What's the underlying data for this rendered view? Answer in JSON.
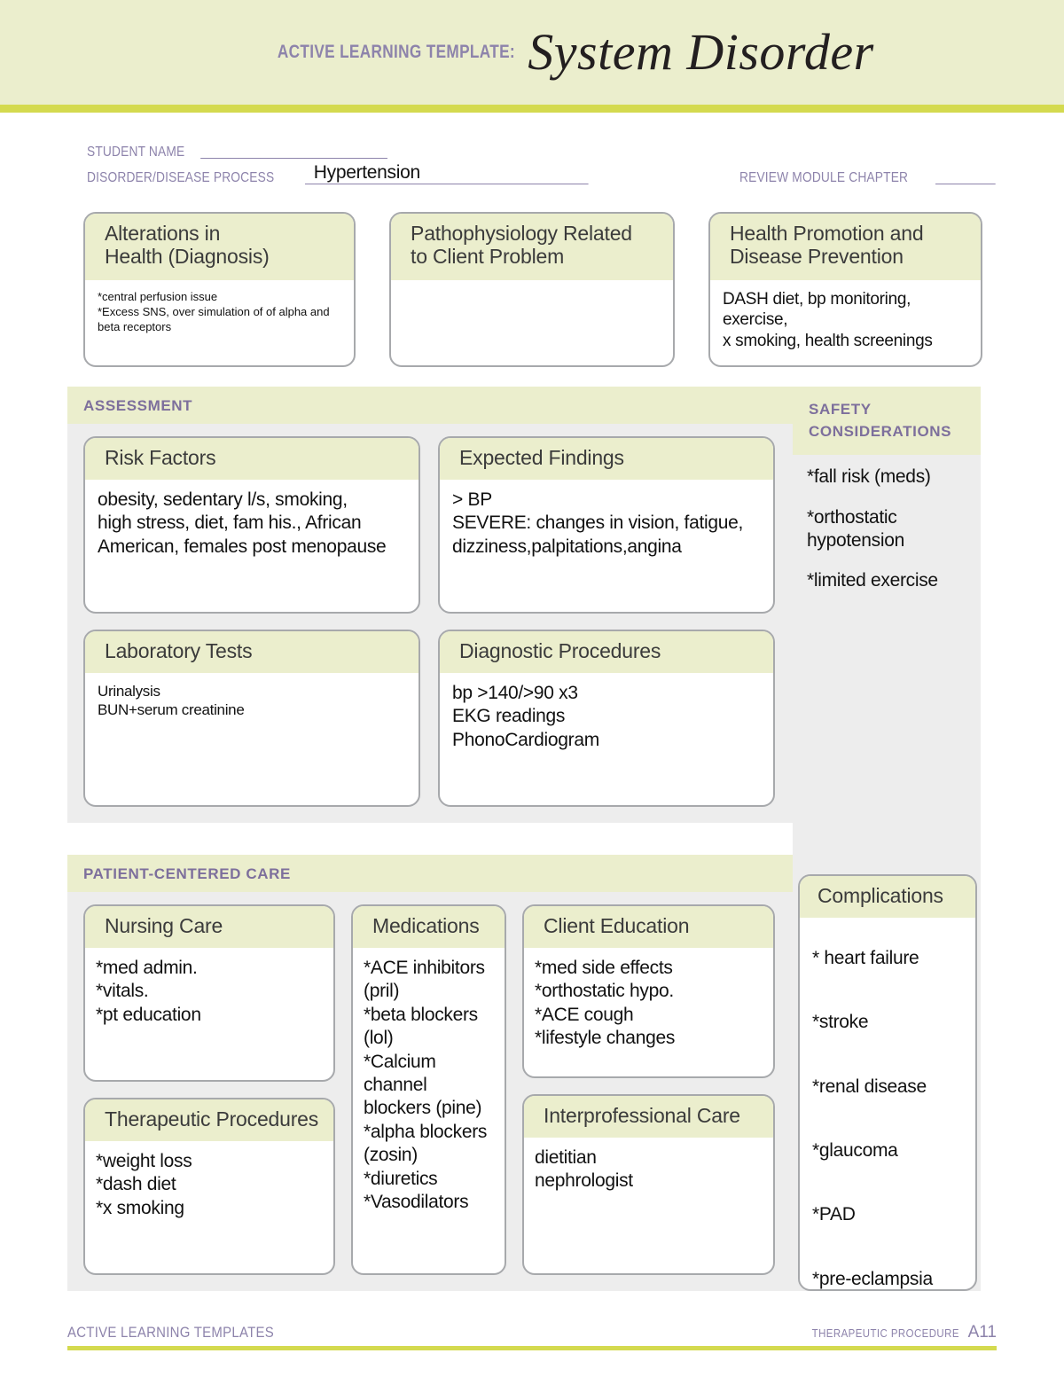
{
  "header": {
    "kicker": "ACTIVE LEARNING TEMPLATE:",
    "title": "System Disorder",
    "band_color": "#ebeecd",
    "rule_color": "#d4da4f",
    "accent_text_color": "#8d83ab"
  },
  "form": {
    "student_name_label": "STUDENT NAME",
    "student_name_value": "",
    "student_name_dashes": "_________________________",
    "disorder_label": "DISORDER/DISEASE PROCESS",
    "disorder_value": "Hypertension",
    "disorder_dashes": "______________________________________",
    "review_label": "REVIEW MODULE CHAPTER",
    "review_value": "",
    "review_dashes": "________"
  },
  "top_boxes": [
    {
      "title": "Alterations in\nHealth (Diagnosis)",
      "body": "*central perfusion issue\n*Excess SNS, over simulation of of alpha and\nbeta receptors"
    },
    {
      "title": "Pathophysiology Related\nto Client Problem",
      "body": ""
    },
    {
      "title": "Health Promotion and\nDisease Prevention",
      "body": "DASH diet, bp monitoring, exercise,\nx smoking, health screenings"
    }
  ],
  "assessment": {
    "section_label": "ASSESSMENT",
    "cards": [
      {
        "title": "Risk Factors",
        "body": "obesity, sedentary l/s, smoking,\nhigh stress, diet, fam his., African\nAmerican, females post menopause"
      },
      {
        "title": "Expected Findings",
        "body": "> BP\nSEVERE: changes in vision, fatigue,\ndizziness,palpitations,angina"
      },
      {
        "title": "Laboratory Tests",
        "body": "Urinalysis\nBUN+serum creatinine"
      },
      {
        "title": "Diagnostic Procedures",
        "body": "bp >140/>90 x3\nEKG readings\nPhonoCardiogram"
      }
    ]
  },
  "safety": {
    "section_label": "SAFETY\nCONSIDERATIONS",
    "items": [
      "*fall risk (meds)",
      "*orthostatic\nhypotension",
      "*limited exercise"
    ]
  },
  "patient_centered_care": {
    "section_label": "PATIENT-CENTERED CARE",
    "nursing_care": {
      "title": "Nursing Care",
      "body": "*med admin.\n*vitals.\n*pt education"
    },
    "therapeutic_procedures": {
      "title": "Therapeutic Procedures",
      "body": "*weight loss\n*dash diet\n*x smoking"
    },
    "medications": {
      "title": "Medications",
      "body": "*ACE inhibitors\n(pril)\n*beta blockers\n(lol)\n*Calcium\nchannel\nblockers (pine)\n*alpha blockers\n(zosin)\n*diuretics\n*Vasodilators"
    },
    "client_education": {
      "title": "Client Education",
      "body": "*med side effects\n*orthostatic hypo.\n*ACE cough\n*lifestyle changes"
    },
    "interprofessional_care": {
      "title": "Interprofessional Care",
      "body": "dietitian\nnephrologist"
    }
  },
  "complications": {
    "title": "Complications",
    "items": [
      "* heart failure",
      "*stroke",
      "*renal disease",
      "*glaucoma",
      "*PAD",
      "*pre-eclampsia"
    ]
  },
  "footer": {
    "left": "ACTIVE LEARNING TEMPLATES",
    "kind": "THERAPEUTIC PROCEDURE",
    "page": "A11"
  }
}
